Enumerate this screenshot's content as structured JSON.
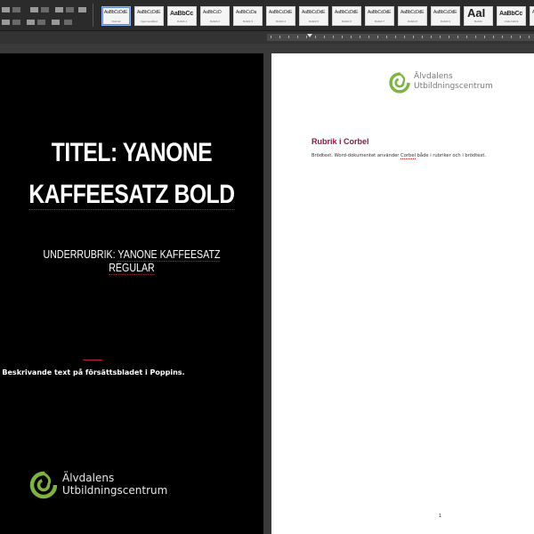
{
  "ribbon": {
    "styles": [
      {
        "sample": "AaBbCcDdE",
        "name": "Normal",
        "selected": true
      },
      {
        "sample": "AaBbCcDdE",
        "name": "Ingen avstånd",
        "selected": false
      },
      {
        "sample": "AaBbCc",
        "name": "Rubrik 1",
        "selected": false
      },
      {
        "sample": "AaBbCcD",
        "name": "Rubrik 2",
        "selected": false
      },
      {
        "sample": "AaBbCcDa",
        "name": "Rubrik 3",
        "selected": false
      },
      {
        "sample": "AaBbCcDdE",
        "name": "Rubrik 4",
        "selected": false
      },
      {
        "sample": "AaBbCcDdE",
        "name": "Rubrik 5",
        "selected": false
      },
      {
        "sample": "AaBbCcDdE",
        "name": "Rubrik 6",
        "selected": false
      },
      {
        "sample": "AaBbCcDdE",
        "name": "Rubrik 7",
        "selected": false
      },
      {
        "sample": "AaBbCcDdE",
        "name": "Rubrik 8",
        "selected": false
      },
      {
        "sample": "AaBbCcDdE",
        "name": "Rubrik 9",
        "selected": false
      },
      {
        "sample": "AaI",
        "name": "Rubrik",
        "selected": false
      },
      {
        "sample": "AaBbCc",
        "name": "Underrubrik",
        "selected": false
      },
      {
        "sample": "AaBbCcDdE",
        "name": "Diskret betoning",
        "selected": false
      }
    ]
  },
  "cover": {
    "title_line1": "TITEL: YANONE",
    "title_line2": "KAFFEESATZ BOLD",
    "subtitle_prefix": "UNDERRUBRIK: ",
    "subtitle_font": "YANONE KAFFEESATZ REGULAR",
    "description": "Beskrivande text på försättsbladet i Poppins.",
    "logo_line1": "Älvdalens",
    "logo_line2": "Utbildningscentrum"
  },
  "content_page": {
    "logo_line1": "Älvdalens",
    "logo_line2": "Utbildningscentrum",
    "heading": "Rubrik i Corbel",
    "body_prefix": "Brödtext. Word-dokumentet använder ",
    "body_font": "Corbel",
    "body_suffix": " både i rubriker och i brödtext.",
    "page_number": "1"
  },
  "colors": {
    "logo_green": "#7cb342",
    "heading_maroon": "#8b1a3d",
    "accent_pink": "#c2185b"
  }
}
